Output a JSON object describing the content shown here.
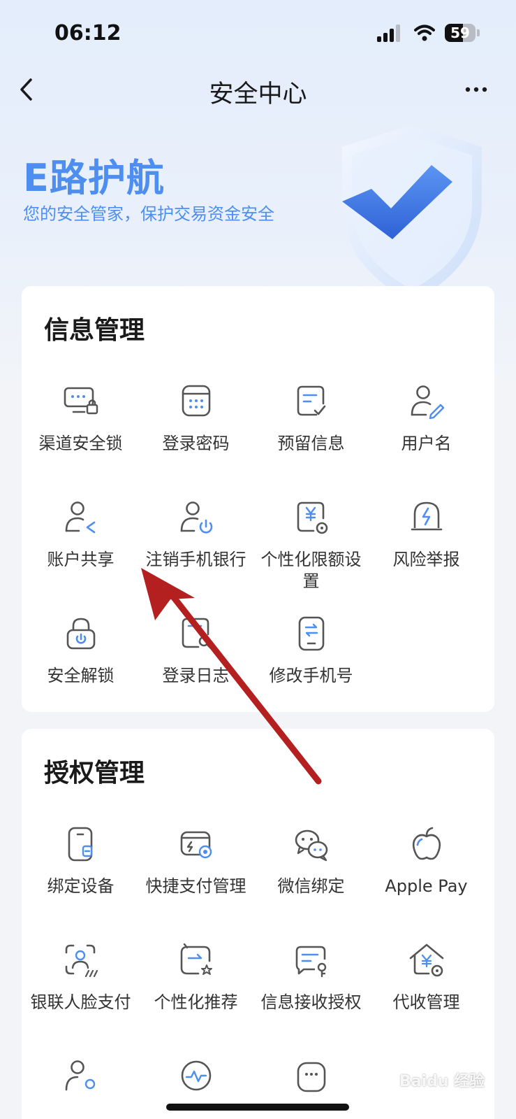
{
  "status_bar": {
    "time": "06:12",
    "battery": "59",
    "battery_level": 0.59
  },
  "nav": {
    "title": "安全中心"
  },
  "hero": {
    "title": "E路护航",
    "subtitle": "您的安全管家，保护交易资金安全"
  },
  "info_section": {
    "title": "信息管理",
    "items": [
      {
        "label": "渠道安全锁",
        "icon": "channel-lock-icon"
      },
      {
        "label": "登录密码",
        "icon": "keypad-icon"
      },
      {
        "label": "预留信息",
        "icon": "reserved-info-icon"
      },
      {
        "label": "用户名",
        "icon": "user-edit-icon"
      },
      {
        "label": "账户共享",
        "icon": "user-share-icon"
      },
      {
        "label": "注销手机银行",
        "icon": "user-power-icon"
      },
      {
        "label": "个性化限额设置",
        "icon": "yen-limit-icon"
      },
      {
        "label": "风险举报",
        "icon": "alarm-icon"
      },
      {
        "label": "安全解锁",
        "icon": "unlock-icon"
      },
      {
        "label": "登录日志",
        "icon": "log-search-icon"
      },
      {
        "label": "修改手机号",
        "icon": "phone-swap-icon"
      }
    ]
  },
  "auth_section": {
    "title": "授权管理",
    "items": [
      {
        "label": "绑定设备",
        "icon": "device-bind-icon"
      },
      {
        "label": "快捷支付管理",
        "icon": "quick-pay-icon"
      },
      {
        "label": "微信绑定",
        "icon": "wechat-icon"
      },
      {
        "label": "Apple Pay",
        "icon": "apple-icon"
      },
      {
        "label": "银联人脸支付",
        "icon": "face-pay-icon"
      },
      {
        "label": "个性化推荐",
        "icon": "recommend-icon"
      },
      {
        "label": "信息接收授权",
        "icon": "message-auth-icon"
      },
      {
        "label": "代收管理",
        "icon": "collection-icon"
      }
    ]
  },
  "watermark": "Baidu 经验",
  "colors": {
    "accent": "#4d8ef0",
    "arrow": "#b3201f",
    "text": "#333333"
  }
}
